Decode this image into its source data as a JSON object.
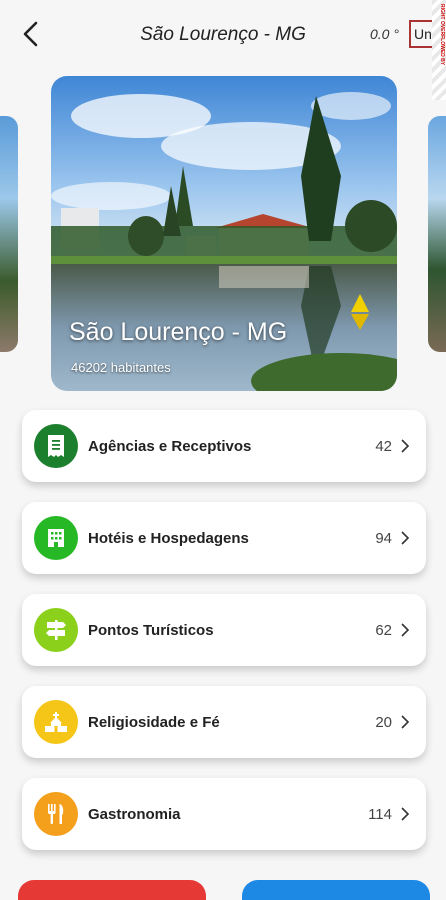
{
  "appbar": {
    "title": "São Lourenço - MG",
    "temperature": "0.0 °",
    "unit_label": "Una",
    "overflow_banner": "RIGHT OVERFLOWED BY"
  },
  "city": {
    "name": "São Lourenço - MG",
    "population": "46202 habitantes"
  },
  "menu": [
    {
      "label": "Agências e Receptivos",
      "count": "42",
      "color": "#1b7f2e",
      "icon": "receipt-icon"
    },
    {
      "label": "Hotéis e Hospedagens",
      "count": "94",
      "color": "#27b826",
      "icon": "hotel-building-icon"
    },
    {
      "label": "Pontos Turísticos",
      "count": "62",
      "color": "#8bd11c",
      "icon": "signpost-icon"
    },
    {
      "label": "Religiosidade e Fé",
      "count": "20",
      "color": "#f5c518",
      "icon": "church-icon"
    },
    {
      "label": "Gastronomia",
      "count": "114",
      "color": "#f4a01c",
      "icon": "fork-knife-icon"
    }
  ],
  "colors": {
    "button_red": "#e53935",
    "button_blue": "#1e88e5"
  }
}
